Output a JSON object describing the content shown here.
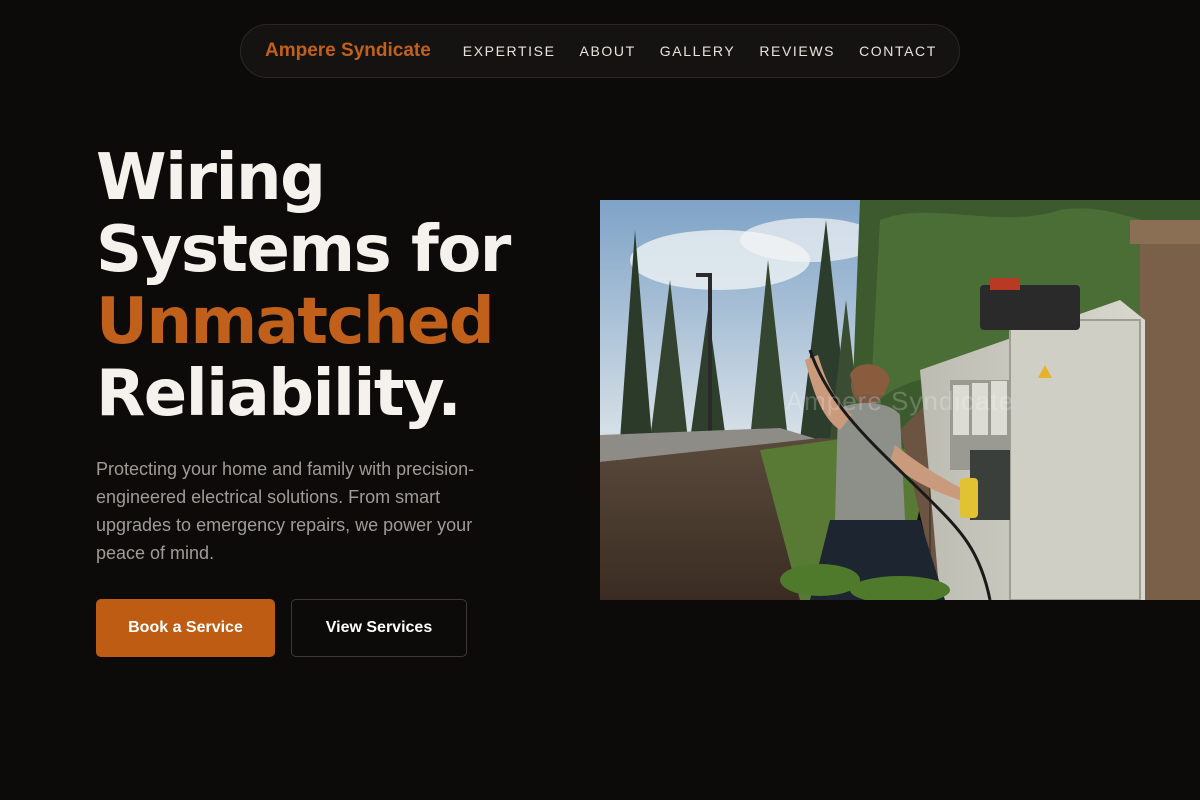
{
  "nav": {
    "brand": "Ampere Syndicate",
    "links": [
      {
        "label": "EXPERTISE"
      },
      {
        "label": "ABOUT"
      },
      {
        "label": "GALLERY"
      },
      {
        "label": "REVIEWS"
      },
      {
        "label": "CONTACT"
      }
    ]
  },
  "hero": {
    "headline": {
      "line1": "Wiring",
      "line2": "Systems for",
      "line3": "Unmatched",
      "line4": "Reliability."
    },
    "description": "Protecting your home and family with precision-engineered electrical solutions. From smart upgrades to emergency repairs, we power your peace of mind.",
    "primary_cta": "Book a Service",
    "secondary_cta": "View Services",
    "image_watermark": "Ampere Syndicate"
  },
  "colors": {
    "accent": "#c0601a",
    "background": "#0c0b0a",
    "text": "#f5f2ee",
    "muted_text": "#a09b95"
  }
}
